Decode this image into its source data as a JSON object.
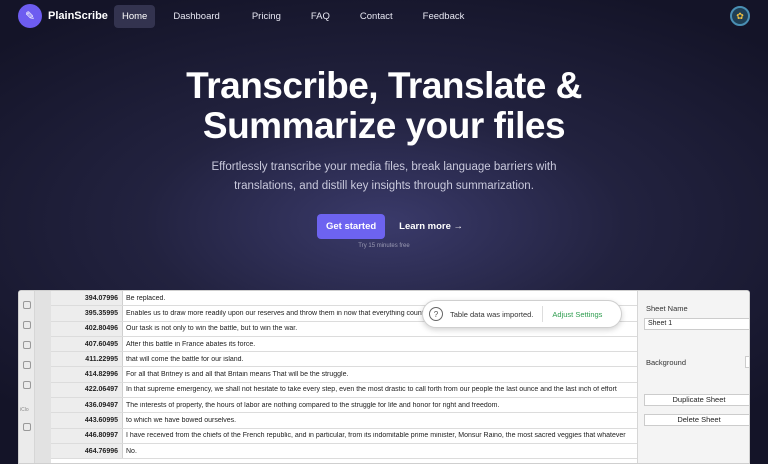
{
  "nav": {
    "logo": "PlainScribe",
    "links": [
      "Home",
      "Dashboard",
      "Pricing",
      "FAQ",
      "Contact",
      "Feedback"
    ],
    "active": "Home"
  },
  "hero": {
    "title_line1": "Transcribe, Translate &",
    "title_line2": "Summarize your files",
    "subtitle": "Effortlessly transcribe your media files, break language barriers with translations, and distill key insights through summarization.",
    "primary_cta": "Get started",
    "secondary_cta": "Learn more →",
    "trial_note": "Try 15 minutes free"
  },
  "sheet": {
    "rows": [
      {
        "time": "394.07996",
        "text": "Be replaced."
      },
      {
        "time": "395.35995",
        "text": "Enables us to draw more readily upon our reserves and throw them in now that everything counts"
      },
      {
        "time": "402.80496",
        "text": "Our task is not only to win the battle, but to win the war."
      },
      {
        "time": "407.60495",
        "text": "After this battle in France abates its force."
      },
      {
        "time": "411.22995",
        "text": "that will come the battle for our island."
      },
      {
        "time": "414.82996",
        "text": "For all that Britney is and all that Britain means That will be the struggle."
      },
      {
        "time": "422.06497",
        "text": "In that supreme emergency, we shall not hesitate to take every step, even the most drastic to call forth from our people the last ounce and the last inch of effort"
      },
      {
        "time": "436.09497",
        "text": "The interests of property, the hours of labor are nothing compared to the struggle for life and honor for right and freedom."
      },
      {
        "time": "443.60995",
        "text": "to which we have bowed ourselves."
      },
      {
        "time": "446.80997",
        "text": "I have received from the chiefs of the French republic, and in particular, from its indomitable prime minister, Monsur Raino, the most sacred veggies that whatever"
      },
      {
        "time": "464.76996",
        "text": "No."
      }
    ],
    "toast": {
      "message": "Table data was imported.",
      "action": "Adjust Settings"
    },
    "side_panel": {
      "sheet_name_label": "Sheet Name",
      "sheet_name_value": "Sheet 1",
      "background_label": "Background",
      "duplicate_label": "Duplicate Sheet",
      "delete_label": "Delete Sheet"
    },
    "rail_text": "iClo"
  }
}
